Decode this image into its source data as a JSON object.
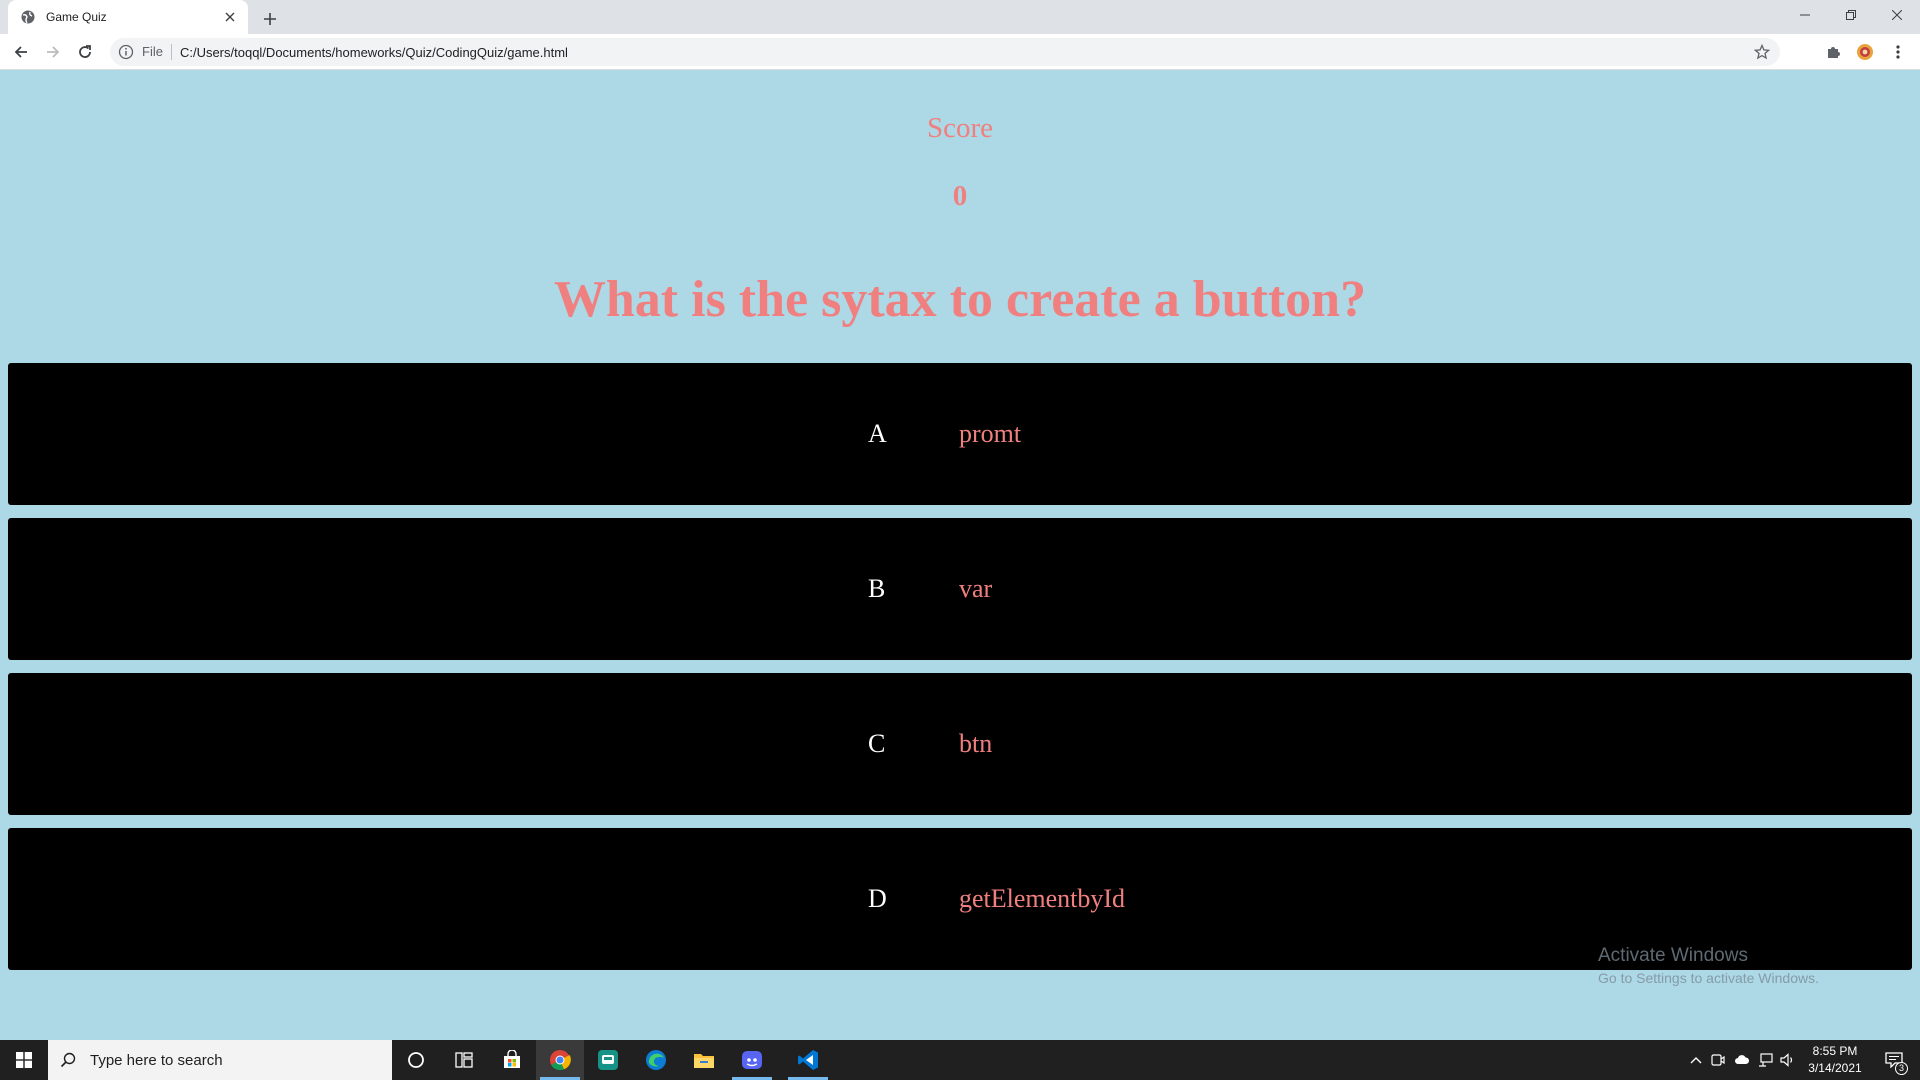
{
  "browser": {
    "tab_title": "Game Quiz",
    "address_scheme": "File",
    "address_url": "C:/Users/toqql/Documents/homeworks/Quiz/CodingQuiz/game.html"
  },
  "quiz": {
    "score_label": "Score",
    "score_value": "0",
    "question": "What is the sytax to create a button?",
    "choices": [
      {
        "letter": "A",
        "text": "promt"
      },
      {
        "letter": "B",
        "text": "var"
      },
      {
        "letter": "C",
        "text": "btn"
      },
      {
        "letter": "D",
        "text": "getElementbyId"
      }
    ],
    "colors": {
      "background": "#add8e6",
      "accent": "#f08080",
      "choice_bg": "#000000",
      "letter": "#ffffff"
    }
  },
  "watermark": {
    "title": "Activate Windows",
    "subtitle": "Go to Settings to activate Windows."
  },
  "taskbar": {
    "search_placeholder": "Type here to search",
    "time": "8:55 PM",
    "date": "3/14/2021",
    "notification_count": "3",
    "apps": [
      "cortana-icon",
      "task-view-icon",
      "store-icon",
      "chrome-icon",
      "gitkraken-icon",
      "edge-icon",
      "file-explorer-icon",
      "discord-icon",
      "vscode-icon"
    ]
  }
}
